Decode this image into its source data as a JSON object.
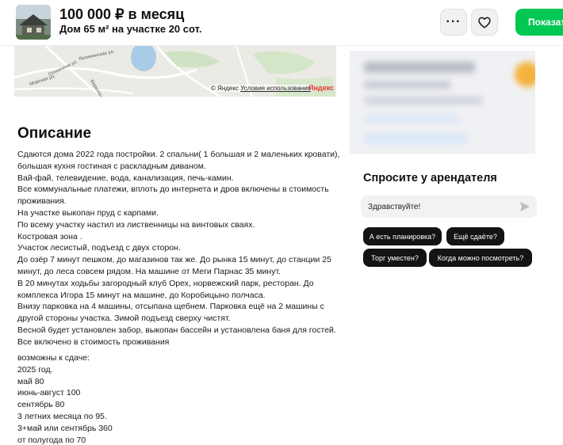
{
  "header": {
    "price": "100 000 ₽ в месяц",
    "subtitle": "Дом 65 м² на участке 20 сот.",
    "more_label": "···",
    "show_button": "Показать"
  },
  "map": {
    "street_labels": [
      "Калининская ул.",
      "Солнечная ул.",
      "Морская ул.",
      "Береговая ул."
    ],
    "copyright": "© Яндекс",
    "terms_link": "Условия использования",
    "logo": "Яндекс"
  },
  "description": {
    "title": "Описание",
    "lines": [
      "Сдаются дома 2022 года постройки. 2 спальни( 1 большая и 2 маленьких кровати),",
      "большая кухня гостиная с раскладным диваном.",
      "Вай-фай, телевидение, вода, канализация, печь-камин.",
      "Все коммунальные платежи, вплоть до интернета и дров включены в стоимость",
      "проживания.",
      "На участке выкопан пруд с карпами.",
      "По всему участку настил из лиственницы на винтовых сваях.",
      "Костровая зона .",
      "Участок лесистый, подъезд с двух сторон.",
      "До озёр 7 минут пешком, до магазинов так же. До рынка 15 минут, до станции 25",
      "минут, до леса совсем рядом. На машине от Меги Парнас 35 минут.",
      "В 20 минутах ходьбы загородный клуб Орех, норвежский парк, ресторан. До",
      "комплекса Игора 15 минут на машине, до Коробицыно полчаса.",
      "Внизу парковка на 4 машины, отсыпана щебнем. Парковка ещё на 2 машины с",
      "другой стороны участка. Зимой подъезд сверху чистят.",
      "Весной будет установлен забор, выкопан бассейн и установлена баня для гостей.",
      "Все включено в стоимость проживания"
    ],
    "terms": [
      "возможны к сдаче:",
      "2025 год.",
      "май 80",
      "июнь-август 100",
      "сентябрь 80",
      "3 летних месяца по 95.",
      "3+май или сентябрь 360",
      "от полугода по 70"
    ]
  },
  "ask": {
    "title": "Спросите у арендателя",
    "input_value": "Здравствуйте!",
    "chips": [
      "А есть планировка?",
      "Ещё сдаёте?",
      "Торг уместен?",
      "Когда можно посмотреть?"
    ]
  }
}
